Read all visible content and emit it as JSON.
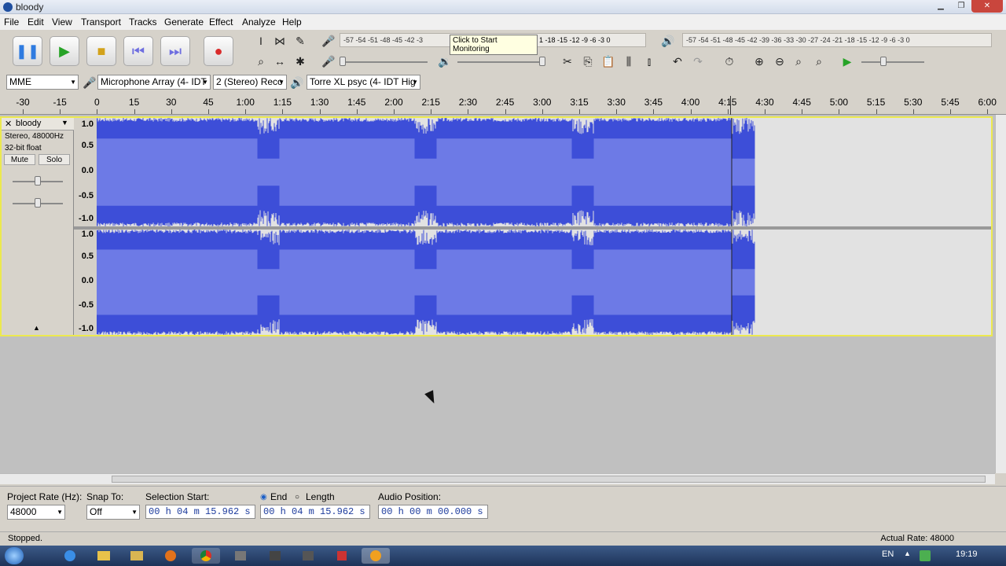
{
  "window": {
    "title": "bloody"
  },
  "menu": [
    "File",
    "Edit",
    "View",
    "Transport",
    "Tracks",
    "Generate",
    "Effect",
    "Analyze",
    "Help"
  ],
  "meter_record": {
    "scale": "-57 -54 -51 -48 -45 -42 -3",
    "tooltip": "Click to Start Monitoring",
    "scale_tail": "1 -18 -15 -12 -9 -6 -3 0"
  },
  "meter_play": {
    "scale": "-57 -54 -51 -48 -45 -42 -39 -36 -33 -30 -27 -24 -21 -18 -15 -12 -9 -6 -3 0"
  },
  "devices": {
    "host": "MME",
    "input": "Microphone Array (4- IDT",
    "channels": "2 (Stereo) Reco",
    "output": "Torre XL psyc (4- IDT Hig"
  },
  "ruler": {
    "ticks": [
      "-30",
      "-15",
      "0",
      "15",
      "30",
      "45",
      "1:00",
      "1:15",
      "1:30",
      "1:45",
      "2:00",
      "2:15",
      "2:30",
      "2:45",
      "3:00",
      "3:15",
      "3:30",
      "3:45",
      "4:00",
      "4:15",
      "4:30",
      "4:45",
      "5:00",
      "5:15",
      "5:30",
      "5:45",
      "6:00"
    ]
  },
  "track": {
    "name": "bloody",
    "info1": "Stereo, 48000Hz",
    "info2": "32-bit float",
    "mute": "Mute",
    "solo": "Solo",
    "scale": [
      "1.0",
      "0.5",
      "0.0",
      "-0.5",
      "-1.0"
    ],
    "wave_color": "#3d4ed8",
    "rms_color": "#6d7ae6"
  },
  "bottom": {
    "project_rate_label": "Project Rate (Hz):",
    "project_rate": "48000",
    "snap_label": "Snap To:",
    "snap": "Off",
    "selection_start_label": "Selection Start:",
    "end_label": "End",
    "length_label": "Length",
    "audio_position_label": "Audio Position:",
    "selection_start": "00 h 04 m 15.962 s",
    "selection_end": "00 h 04 m 15.962 s",
    "audio_position": "00 h 00 m 00.000 s"
  },
  "status": {
    "left": "Stopped.",
    "right": "Actual Rate: 48000"
  },
  "taskbar": {
    "lang": "EN",
    "clock": "19:19"
  }
}
